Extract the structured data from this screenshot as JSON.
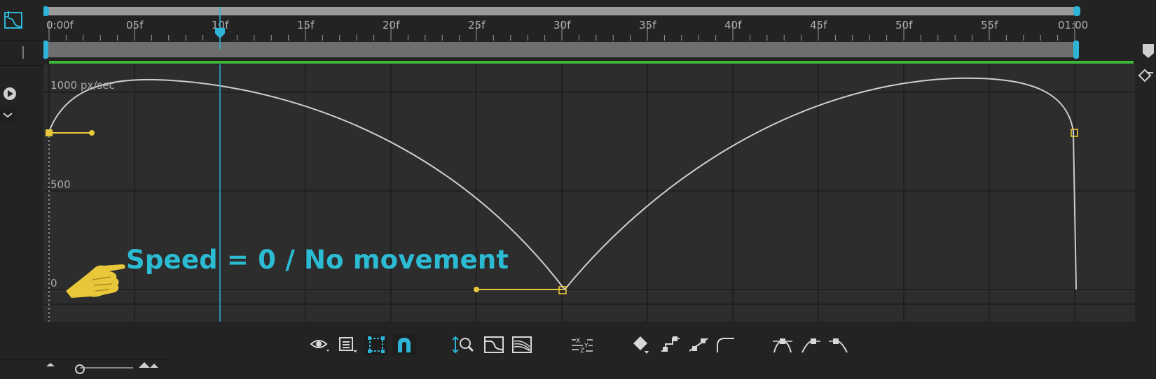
{
  "ruler": {
    "ticks": [
      "0:00f",
      "05f",
      "10f",
      "15f",
      "20f",
      "25f",
      "30f",
      "35f",
      "40f",
      "45f",
      "50f",
      "55f",
      "01:00"
    ]
  },
  "graph": {
    "y_labels": [
      "1000 px/sec",
      "500",
      "0"
    ],
    "curve_color": "#cfcfcf",
    "handle_color": "#e8c83a",
    "playhead_color": "#2eb4d6"
  },
  "annotation": {
    "text": "Speed = 0 / No movement",
    "color": "#2bbcd4"
  },
  "icons": {
    "left": [
      "graph-type-icon",
      "play-icon",
      "dropdown-icon"
    ],
    "toolbar": [
      "show-properties-icon",
      "graph-options-icon",
      "transform-box-icon",
      "snapping-icon",
      "fit-selection-icon",
      "fit-all-graphs-icon",
      "fit-all-icon",
      "separate-dimensions-icon",
      "edit-keyframe-icon",
      "hold-icon",
      "linear-icon",
      "auto-bezier-icon",
      "easy-ease-icon",
      "easy-ease-in-icon",
      "easy-ease-out-icon"
    ]
  }
}
